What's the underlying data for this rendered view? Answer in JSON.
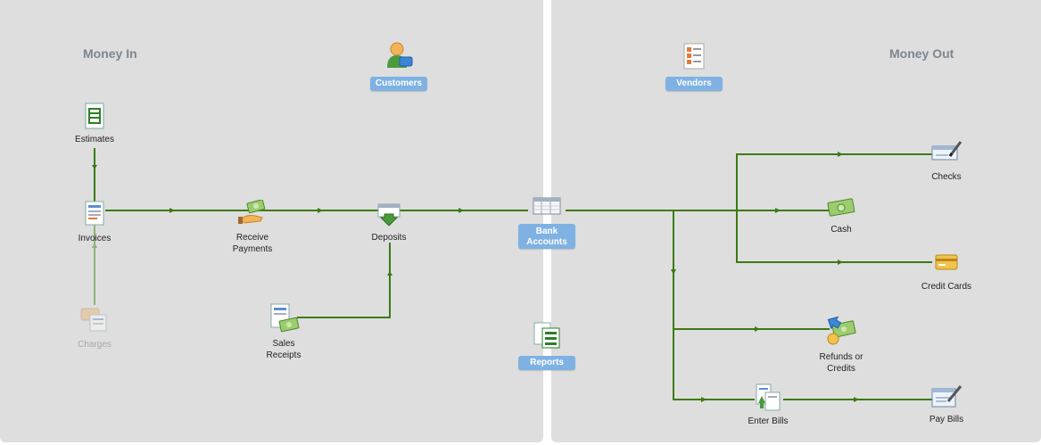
{
  "sections": {
    "money_in": "Money In",
    "money_out": "Money Out"
  },
  "centers": {
    "customers": "Customers",
    "vendors": "Vendors",
    "bank_accounts": "Bank\nAccounts",
    "reports": "Reports"
  },
  "nodes": {
    "estimates": "Estimates",
    "invoices": "Invoices",
    "charges": "Charges",
    "receive_payments_1": "Receive",
    "receive_payments_2": "Payments",
    "deposits": "Deposits",
    "sales_receipts_1": "Sales",
    "sales_receipts_2": "Receipts",
    "checks": "Checks",
    "cash": "Cash",
    "credit_cards": "Credit Cards",
    "refunds_1": "Refunds or",
    "refunds_2": "Credits",
    "enter_bills": "Enter Bills",
    "pay_bills": "Pay Bills"
  },
  "colors": {
    "flow_line": "#3c7a12",
    "faded_line": "#8fb27a",
    "pill": "#7fb2e3",
    "title": "#7d8690",
    "panel": "#dedede"
  }
}
